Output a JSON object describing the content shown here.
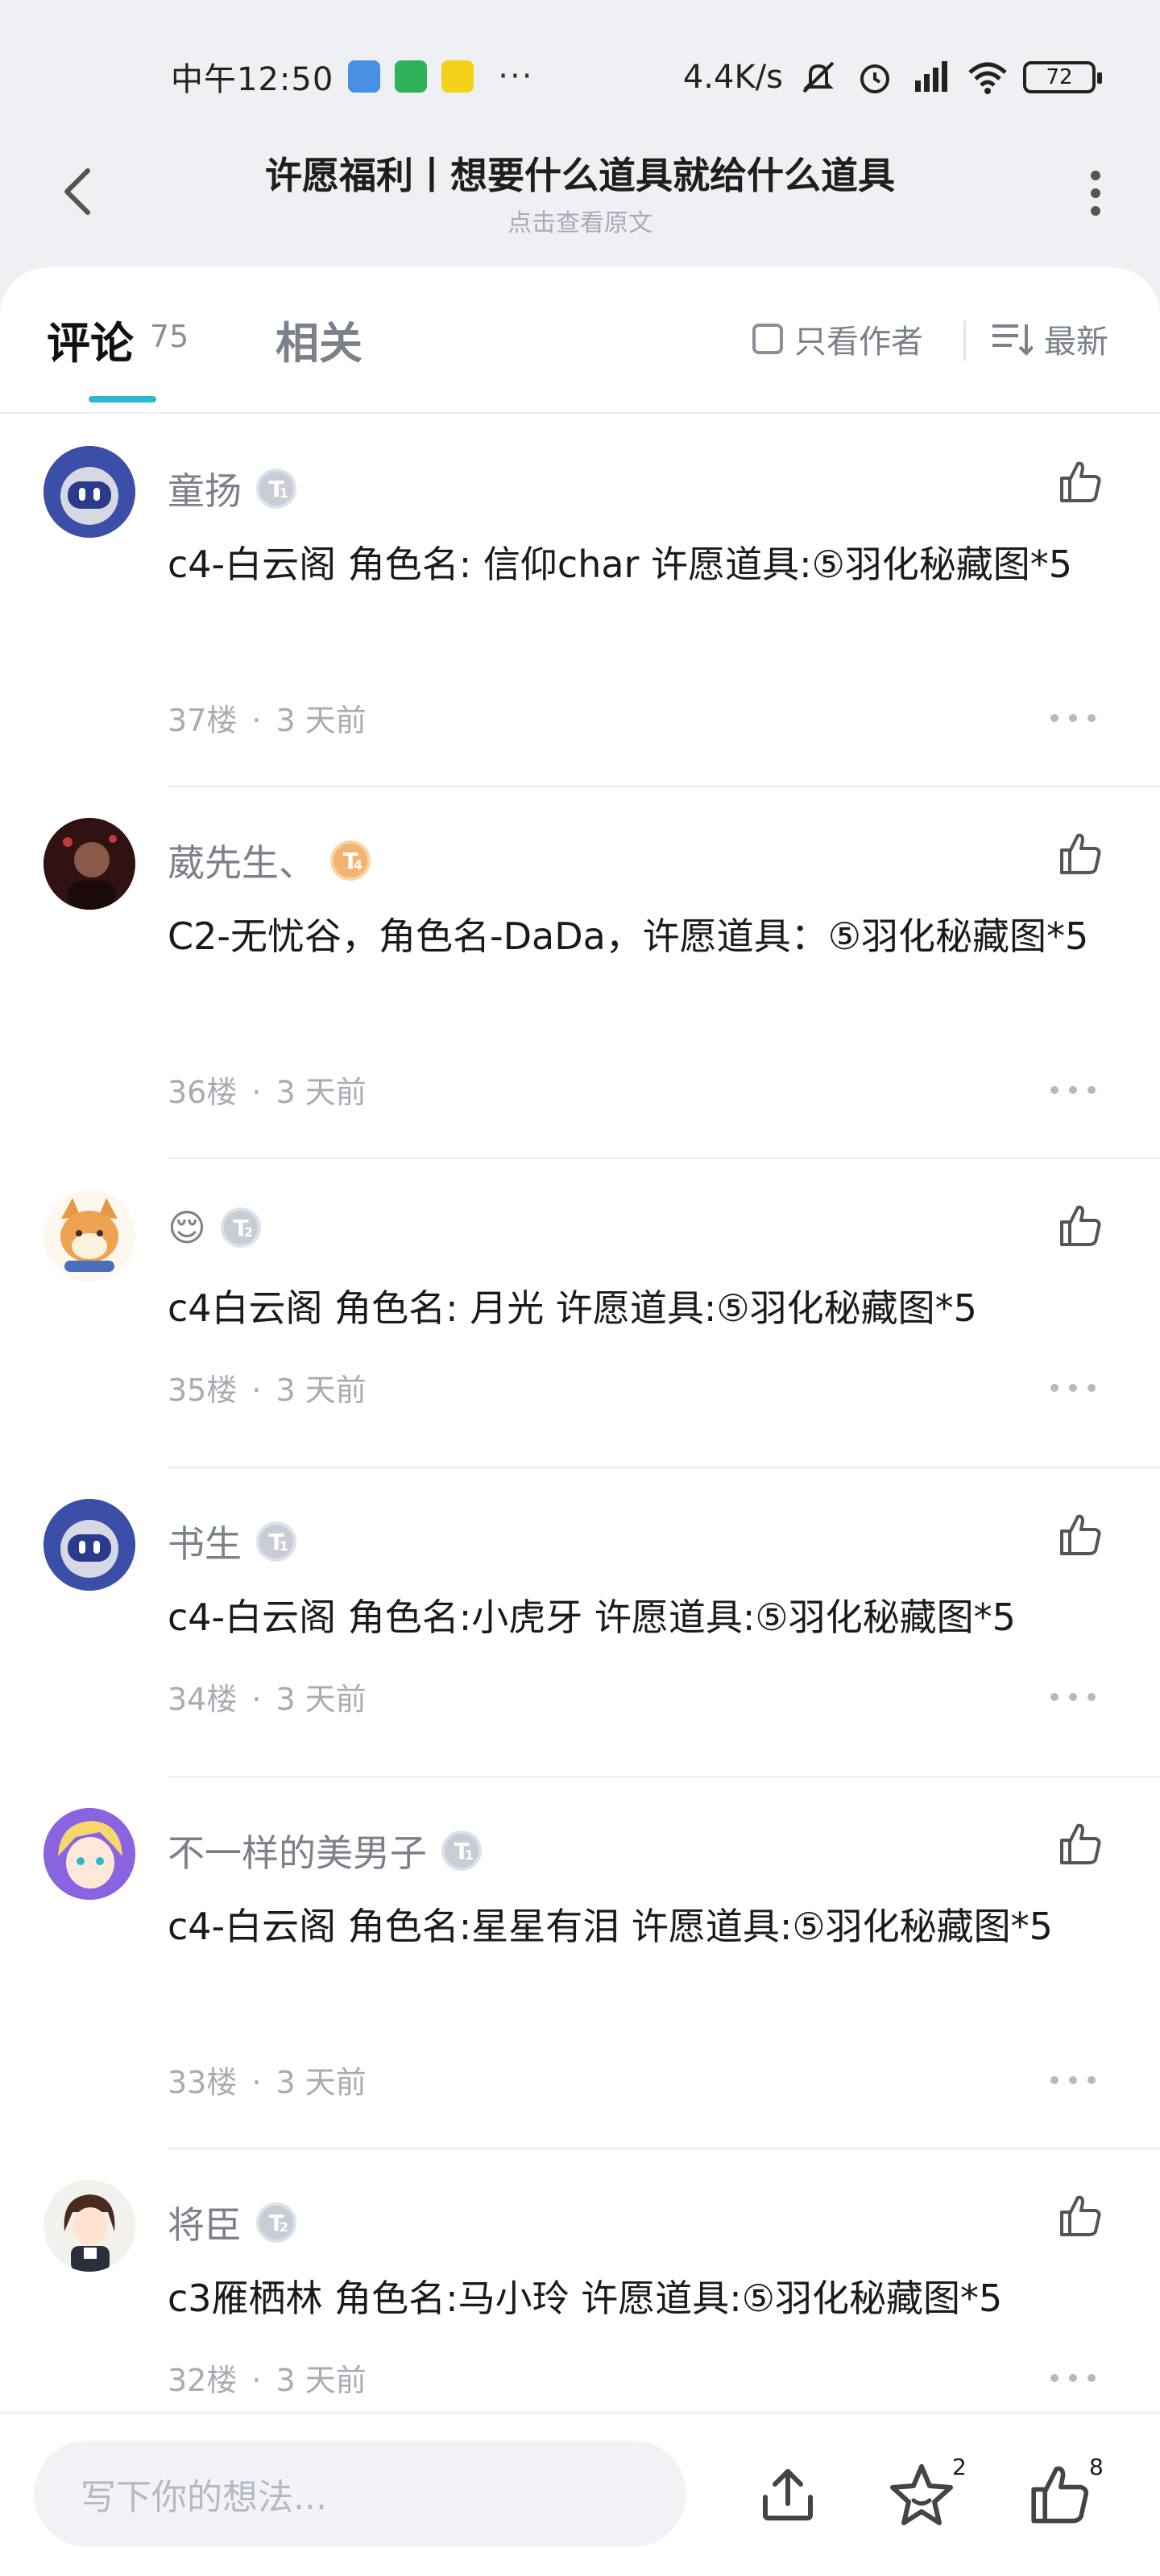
{
  "status_bar": {
    "time": "中午12:50",
    "dots": "···",
    "network_speed": "4.4K/s",
    "battery": "72"
  },
  "header": {
    "title": "许愿福利丨想要什么道具就给什么道具",
    "subtitle": "点击查看原文"
  },
  "tabs": {
    "comments_label": "评论",
    "comments_count": "75",
    "related_label": "相关",
    "only_author_label": "只看作者",
    "sort_label": "最新"
  },
  "comments": [
    {
      "username": "童扬",
      "level": "T",
      "level_num": "1",
      "text": "c4-白云阁 角色名: 信仰char  许愿道具:⑤羽化秘藏图*5",
      "floor": "37楼",
      "time": "3 天前"
    },
    {
      "username": "葳先生、",
      "level": "T",
      "level_num": "4",
      "text": "C2-无忧谷，角色名-DaDa，许愿道具：⑤羽化秘藏图*5",
      "floor": "36楼",
      "time": "3 天前"
    },
    {
      "username": "😌",
      "level": "T",
      "level_num": "2",
      "text": "c4白云阁  角色名:    月光    许愿道具:⑤羽化秘藏图*5",
      "floor": "35楼",
      "time": "3 天前"
    },
    {
      "username": "书生",
      "level": "T",
      "level_num": "1",
      "text": "c4-白云阁 角色名:小虎牙  许愿道具:⑤羽化秘藏图*5",
      "floor": "34楼",
      "time": "3 天前"
    },
    {
      "username": "不一样的美男子",
      "level": "T",
      "level_num": "1",
      "text": "c4-白云阁 角色名:星星有泪  许愿道具:⑤羽化秘藏图*5",
      "floor": "33楼",
      "time": "3 天前"
    },
    {
      "username": "将臣",
      "level": "T",
      "level_num": "2",
      "text": "c3雁栖林 角色名:马小玲   许愿道具:⑤羽化秘藏图*5",
      "floor": "32楼",
      "time": "3 天前"
    }
  ],
  "bottom_bar": {
    "input_placeholder": "写下你的想法...",
    "favorite_count": "2",
    "like_count": "8"
  },
  "colors": {
    "accent": "#2bb9cf",
    "background": "#eef0f4",
    "muted_text": "#a7abb3"
  },
  "icons": [
    "back-arrow-icon",
    "more-vertical-icon",
    "checkbox-icon",
    "sort-icon",
    "thumbs-up-icon",
    "more-horizontal-icon",
    "share-icon",
    "star-icon"
  ]
}
